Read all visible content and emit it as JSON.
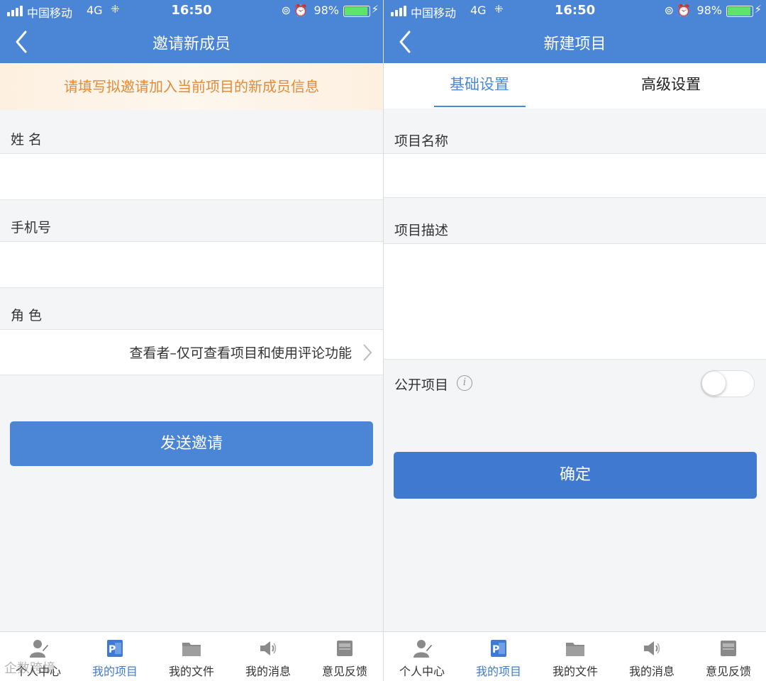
{
  "status": {
    "carrier": "中国移动",
    "network": "4G",
    "time": "16:50",
    "battery_percent": "98%",
    "battery_level": 0.98,
    "battery_color": "#5fe36b"
  },
  "colors": {
    "header": "#4a85d6",
    "primary_button": "#3f7ad0",
    "notice_text": "#e28a3a",
    "active_tab": "#4a8ad4"
  },
  "left": {
    "title": "邀请新成员",
    "notice": "请填写拟邀请加入当前项目的新成员信息",
    "name_label": "姓 名",
    "name_value": "",
    "phone_label": "手机号",
    "phone_value": "",
    "role_label": "角 色",
    "role_value": "查看者–仅可查看项目和使用评论功能",
    "send_button": "发送邀请"
  },
  "right": {
    "title": "新建项目",
    "tabs": [
      "基础设置",
      "高级设置"
    ],
    "active_tab_index": 0,
    "project_name_label": "项目名称",
    "project_name_value": "",
    "project_desc_label": "项目描述",
    "project_desc_value": "",
    "public_label": "公开项目",
    "public_enabled": false,
    "confirm_button": "确定"
  },
  "tabbar": {
    "items": [
      {
        "label": "个人中心",
        "icon": "person-icon"
      },
      {
        "label": "我的项目",
        "icon": "project-icon"
      },
      {
        "label": "我的文件",
        "icon": "folder-icon"
      },
      {
        "label": "我的消息",
        "icon": "speaker-icon"
      },
      {
        "label": "意见反馈",
        "icon": "inbox-icon"
      }
    ],
    "active_index": 1
  },
  "watermark": "企数跨境"
}
